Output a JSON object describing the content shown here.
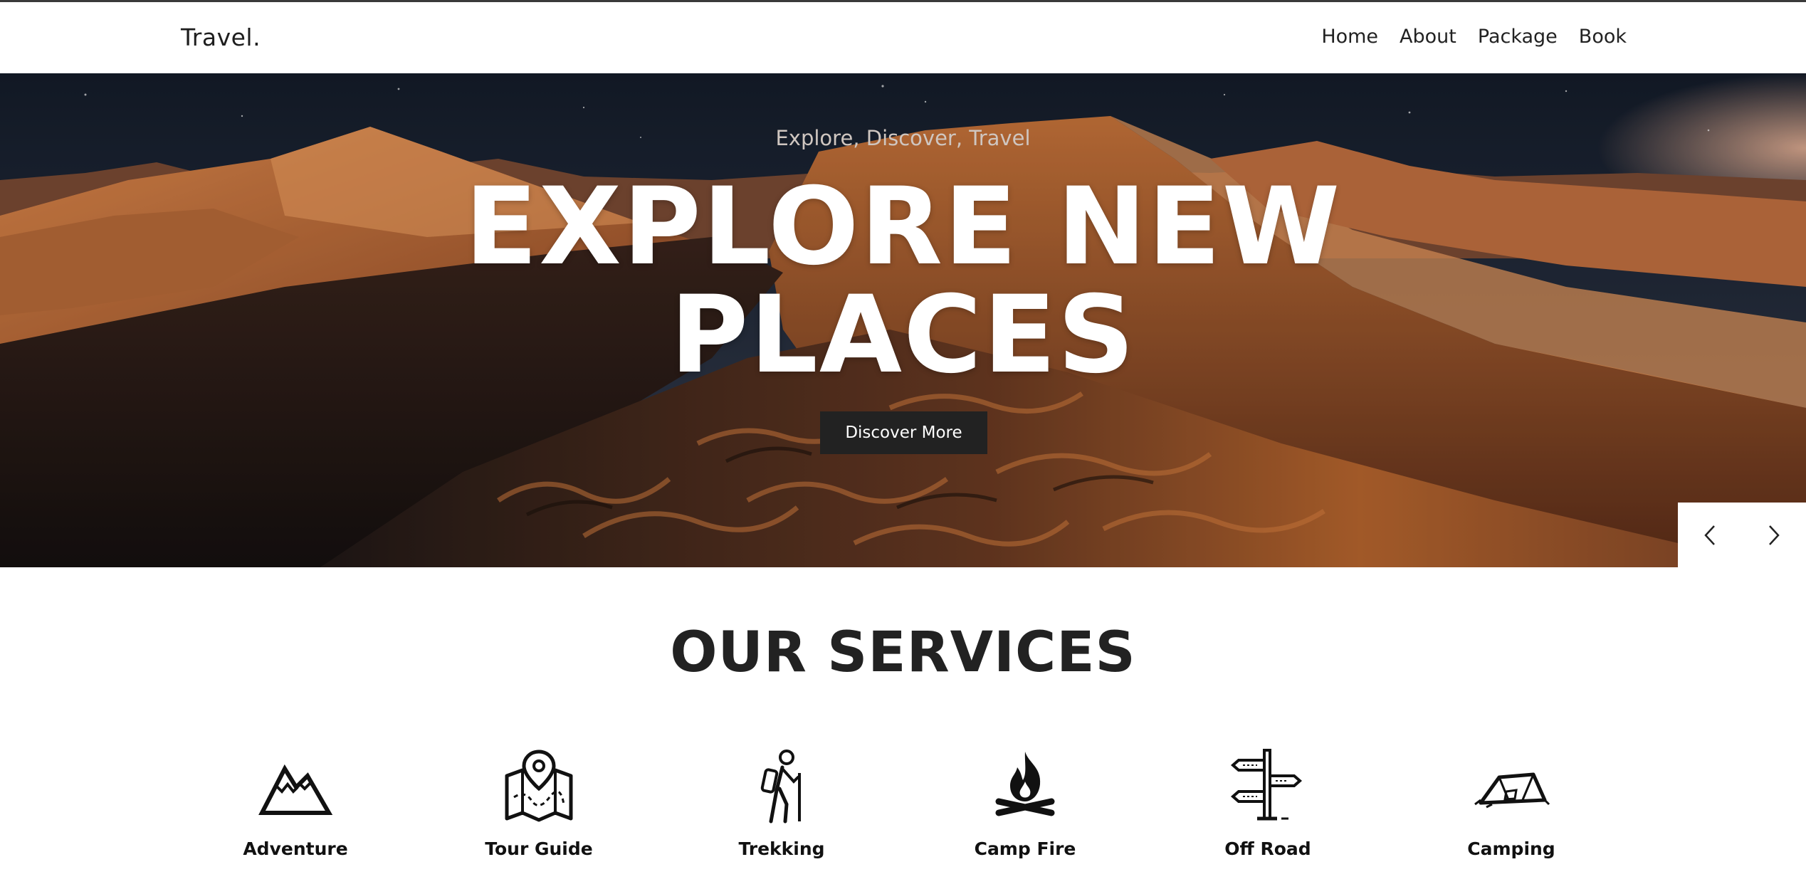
{
  "navbar": {
    "brand": "Travel.",
    "links": [
      "Home",
      "About",
      "Package",
      "Book"
    ]
  },
  "hero": {
    "subtitle": "Explore, Discover, Travel",
    "title_line1": "EXPLORE NEW",
    "title_line2": "PLACES",
    "button_label": "Discover More"
  },
  "slider": {
    "prev_icon": "chevron-left-icon",
    "next_icon": "chevron-right-icon"
  },
  "services": {
    "title": "OUR SERVICES",
    "items": [
      {
        "label": "Adventure",
        "icon": "mountain-icon"
      },
      {
        "label": "Tour Guide",
        "icon": "map-pin-icon"
      },
      {
        "label": "Trekking",
        "icon": "hiker-icon"
      },
      {
        "label": "Camp Fire",
        "icon": "campfire-icon"
      },
      {
        "label": "Off Road",
        "icon": "signpost-icon"
      },
      {
        "label": "Camping",
        "icon": "tent-icon"
      }
    ]
  },
  "colors": {
    "button_bg": "#222222",
    "text_dark": "#222222",
    "sand": "#c8743a"
  }
}
